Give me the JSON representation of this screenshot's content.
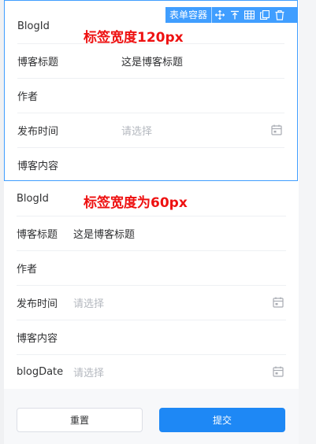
{
  "form1": {
    "annotation": "标签宽度120px",
    "toolbar": {
      "tag": "表单容器",
      "icons": [
        "move-icon",
        "select-parent-icon",
        "table-icon",
        "copy-icon",
        "delete-icon"
      ]
    },
    "rows": [
      {
        "label": "BlogId",
        "value": ""
      },
      {
        "label": "博客标题",
        "value": "这是博客标题"
      },
      {
        "label": "作者",
        "value": ""
      },
      {
        "label": "发布时间",
        "placeholder": "请选择"
      },
      {
        "label": "博客内容",
        "value": ""
      }
    ]
  },
  "form2": {
    "annotation": "标签宽度为60px",
    "rows": [
      {
        "label": "BlogId",
        "value": ""
      },
      {
        "label": "博客标题",
        "value": "这是博客标题"
      },
      {
        "label": "作者",
        "value": ""
      },
      {
        "label": "发布时间",
        "placeholder": "请选择"
      },
      {
        "label": "博客内容",
        "value": ""
      },
      {
        "label": "blogDate",
        "placeholder": "请选择"
      }
    ]
  },
  "footer": {
    "reset_label": "重置",
    "submit_label": "提交"
  },
  "colors": {
    "accent": "#409eff",
    "submit": "#1e88f5",
    "annotation": "#ee1111",
    "placeholder": "#b4b8bf"
  }
}
